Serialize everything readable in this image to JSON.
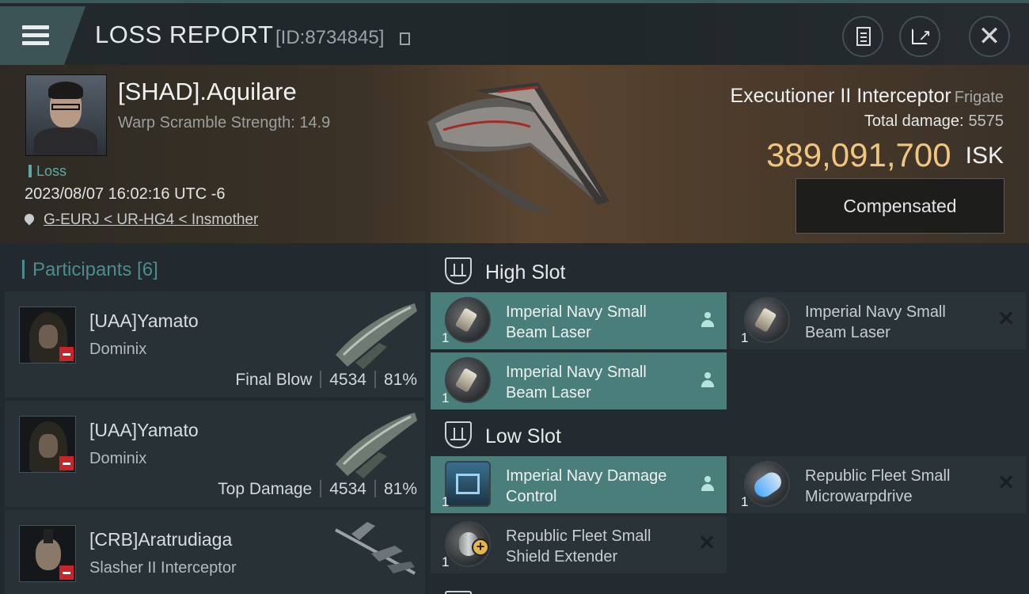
{
  "header": {
    "title": "LOSS REPORT",
    "report_id": "[ID:8734845]"
  },
  "victim": {
    "name": "[SHAD].Aquilare",
    "warp_scramble": "Warp Scramble Strength: 14.9",
    "tag": "Loss",
    "datetime": "2023/08/07 16:02:16 UTC -6",
    "location": "G-EURJ < UR-HG4 < Insmother",
    "ship_name": "Executioner II Interceptor",
    "ship_class": "Frigate",
    "total_damage_label": "Total damage:",
    "total_damage": "5575",
    "isk_value": "389,091,700",
    "isk_unit": "ISK",
    "compensated_label": "Compensated"
  },
  "participants": {
    "title": "Participants [6]",
    "items": [
      {
        "name": "[UAA]Yamato",
        "ship": "Dominix",
        "role": "Final Blow",
        "damage": "4534",
        "percent": "81%"
      },
      {
        "name": "[UAA]Yamato",
        "ship": "Dominix",
        "role": "Top Damage",
        "damage": "4534",
        "percent": "81%"
      },
      {
        "name": "[CRB]Aratrudiaga",
        "ship": "Slasher II Interceptor",
        "role": "",
        "damage": "",
        "percent": ""
      }
    ]
  },
  "slots": {
    "high": {
      "title": "High Slot",
      "modules": [
        {
          "name": "Imperial Navy Small Beam Laser",
          "qty": "1",
          "status": "dropped"
        },
        {
          "name": "Imperial Navy Small Beam Laser",
          "qty": "1",
          "status": "destroyed"
        },
        {
          "name": "Imperial Navy Small Beam Laser",
          "qty": "1",
          "status": "dropped"
        }
      ]
    },
    "low": {
      "title": "Low Slot",
      "modules": [
        {
          "name": "Imperial Navy Damage Control",
          "qty": "1",
          "status": "dropped"
        },
        {
          "name": "Republic Fleet Small Microwarpdrive",
          "qty": "1",
          "status": "destroyed"
        },
        {
          "name": "Republic Fleet Small Shield Extender",
          "qty": "1",
          "status": "destroyed"
        }
      ]
    }
  },
  "colors": {
    "accent_teal": "#4d8c8c",
    "dropped_bg": "#4a7e7b",
    "isk_gold": "#f1c67e",
    "loss_badge_red": "#c8242a"
  },
  "icons": {
    "menu": "menu-icon",
    "copy": "copy-icon",
    "clipboard": "clipboard-icon",
    "share": "share-icon",
    "close": "close-icon",
    "location": "location-pin-icon",
    "slot": "slot-icon",
    "pilot": "person-icon",
    "destroyed": "x-icon"
  }
}
